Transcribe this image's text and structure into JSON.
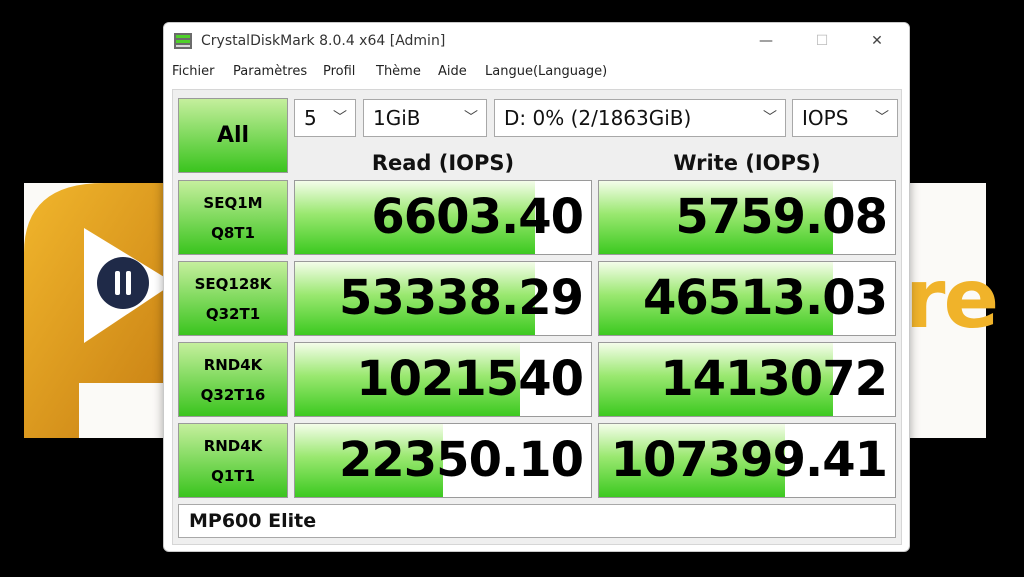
{
  "window": {
    "title": "CrystalDiskMark 8.0.4 x64 [Admin]",
    "minimize": "—",
    "maximize": "☐",
    "close": "✕"
  },
  "menu": [
    "Fichier",
    "Paramètres",
    "Profil",
    "Thème",
    "Aide",
    "Langue(Language)"
  ],
  "controls": {
    "all_label": "All",
    "count": "5",
    "size": "1GiB",
    "drive": "D: 0% (2/1863GiB)",
    "unit": "IOPS"
  },
  "headers": {
    "read": "Read (IOPS)",
    "write": "Write (IOPS)"
  },
  "rows": [
    {
      "line1": "SEQ1M",
      "line2": "Q8T1",
      "read": "6603.40",
      "write": "5759.08",
      "read_fill": 0.81,
      "write_fill": 0.79
    },
    {
      "line1": "SEQ128K",
      "line2": "Q32T1",
      "read": "53338.29",
      "write": "46513.03",
      "read_fill": 0.81,
      "write_fill": 0.79
    },
    {
      "line1": "RND4K",
      "line2": "Q32T16",
      "read": "1021540",
      "write": "1413072",
      "read_fill": 0.76,
      "write_fill": 0.79
    },
    {
      "line1": "RND4K",
      "line2": "Q1T1",
      "read": "22350.10",
      "write": "107399.41",
      "read_fill": 0.5,
      "write_fill": 0.63
    }
  ],
  "comment": "MP600 Elite",
  "colors": {
    "accent_green": "#3ac41e",
    "logo_orange": "#f0b32a",
    "logo_navy": "#1f2a48"
  }
}
